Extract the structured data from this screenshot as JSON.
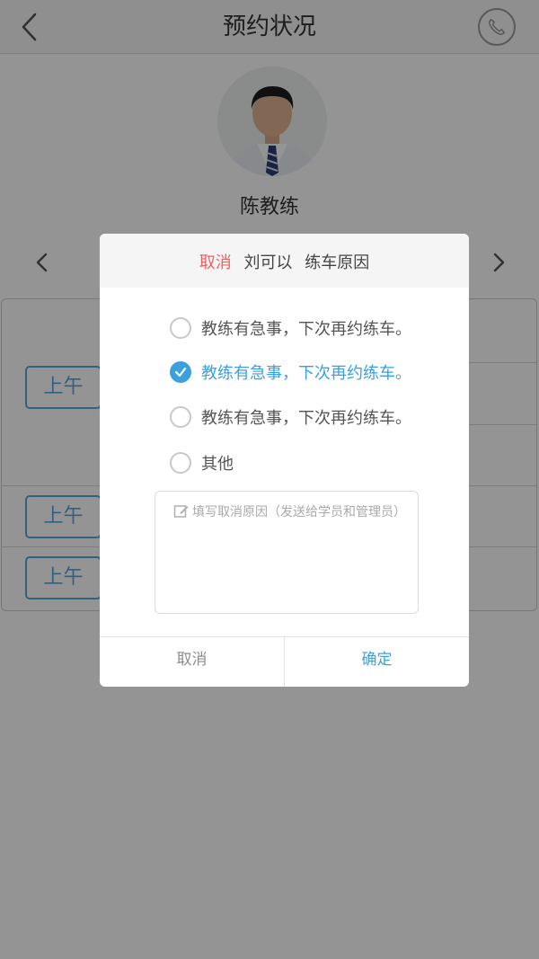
{
  "nav": {
    "title": "预约状况",
    "back_icon": "chevron-left-icon",
    "phone_icon": "phone-icon"
  },
  "coach": {
    "name": "陈教练",
    "avatar": "coach-avatar-photo"
  },
  "date_nav": {
    "prev_icon": "chevron-left-icon",
    "next_icon": "chevron-right-icon"
  },
  "slots": [
    {
      "label": "上午"
    },
    {
      "label": "上午"
    },
    {
      "label": "上午"
    }
  ],
  "dialog": {
    "header": {
      "action": "取消",
      "student": "刘可以",
      "subject": "练车原因"
    },
    "options": [
      {
        "label": "教练有急事，下次再约练车。",
        "checked": false
      },
      {
        "label": "教练有急事，下次再约练车。",
        "checked": true
      },
      {
        "label": "教练有急事，下次再约练车。",
        "checked": false
      },
      {
        "label": "其他",
        "checked": false
      }
    ],
    "reason_placeholder": "填写取消原因（发送给学员和管理员）",
    "buttons": {
      "cancel": "取消",
      "confirm": "确定"
    }
  },
  "colors": {
    "accent": "#3aa1dc",
    "cancel_red": "#f06060",
    "overlay": "rgba(0,0,0,0.42)"
  }
}
